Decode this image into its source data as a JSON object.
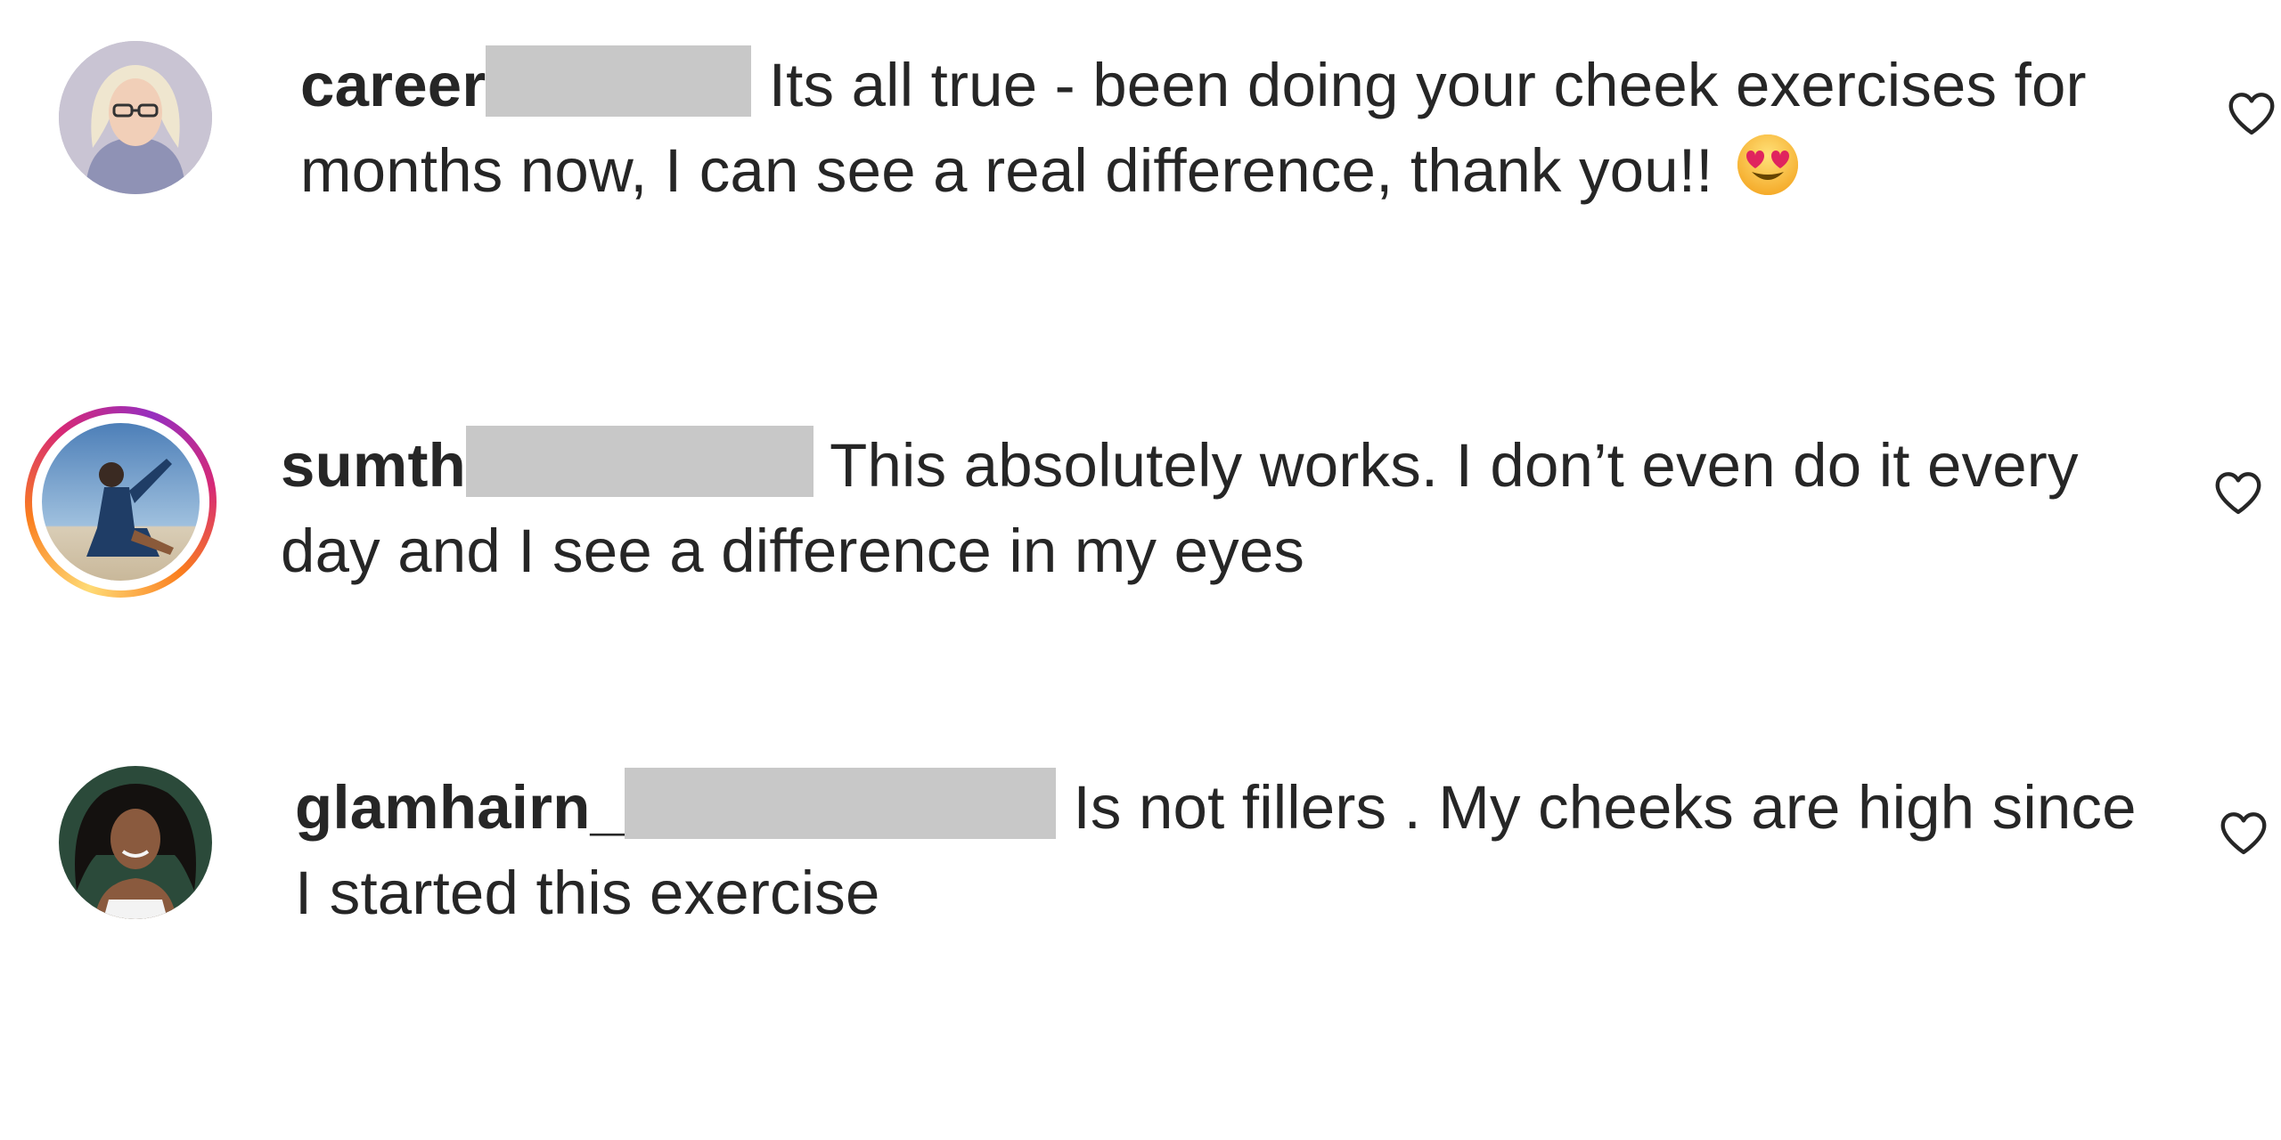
{
  "comments": [
    {
      "username": "career",
      "text": "Its all true - been doing your cheek exercises for months now, I can see a real difference, thank you!!",
      "emoji": "heart-eyes-emoji",
      "like_icon": "heart-outline-icon",
      "has_story_ring": false
    },
    {
      "username": "sumth",
      "text": "This absolutely works. I don’t even do it every day and I see a difference in my eyes",
      "like_icon": "heart-outline-icon",
      "has_story_ring": true
    },
    {
      "username": "glamhairn_",
      "text": "Is not fillers . My cheeks are high since I started this exercise",
      "like_icon": "heart-outline-icon",
      "has_story_ring": false
    }
  ],
  "colors": {
    "text": "#262626",
    "redaction": "#c8c8c8",
    "story_ring": [
      "#feda75",
      "#fa7e1e",
      "#d62976",
      "#962fbf"
    ]
  }
}
